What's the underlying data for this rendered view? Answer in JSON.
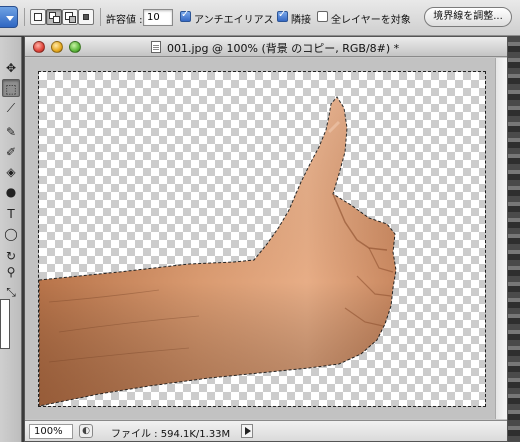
{
  "options_bar": {
    "tolerance_label": "許容値 :",
    "tolerance_value": "10",
    "antialias_label": "アンチエイリアス",
    "antialias_checked": true,
    "contiguous_label": "隣接",
    "contiguous_checked": true,
    "sample_all_layers_label": "全レイヤーを対象",
    "sample_all_layers_checked": false,
    "refine_edge_label": "境界線を調整..."
  },
  "toolbox": {
    "tools": [
      {
        "name": "move-tool-icon",
        "glyph": "▸✥"
      },
      {
        "name": "quick-selection-tool-icon",
        "glyph": "⬚"
      },
      {
        "name": "eyedropper-tool-icon",
        "glyph": "⟋"
      },
      {
        "name": "brush-tool-icon",
        "glyph": "✎"
      },
      {
        "name": "history-brush-tool-icon",
        "glyph": "✐"
      },
      {
        "name": "paint-bucket-tool-icon",
        "glyph": "◈"
      },
      {
        "name": "burn-tool-icon",
        "glyph": "●"
      },
      {
        "name": "type-tool-icon",
        "glyph": "T"
      },
      {
        "name": "ellipse-tool-icon",
        "glyph": "◯"
      },
      {
        "name": "rotate-view-tool-icon",
        "glyph": "↻"
      },
      {
        "name": "zoom-tool-icon",
        "glyph": "⚲"
      },
      {
        "name": "swap-colors-icon",
        "glyph": "⤡"
      }
    ]
  },
  "document": {
    "title": "001.jpg @ 100% (背景 のコピー, RGB/8#) *",
    "zoom": "100%",
    "file_info": "ファイル : 594.1K/1.33M"
  }
}
